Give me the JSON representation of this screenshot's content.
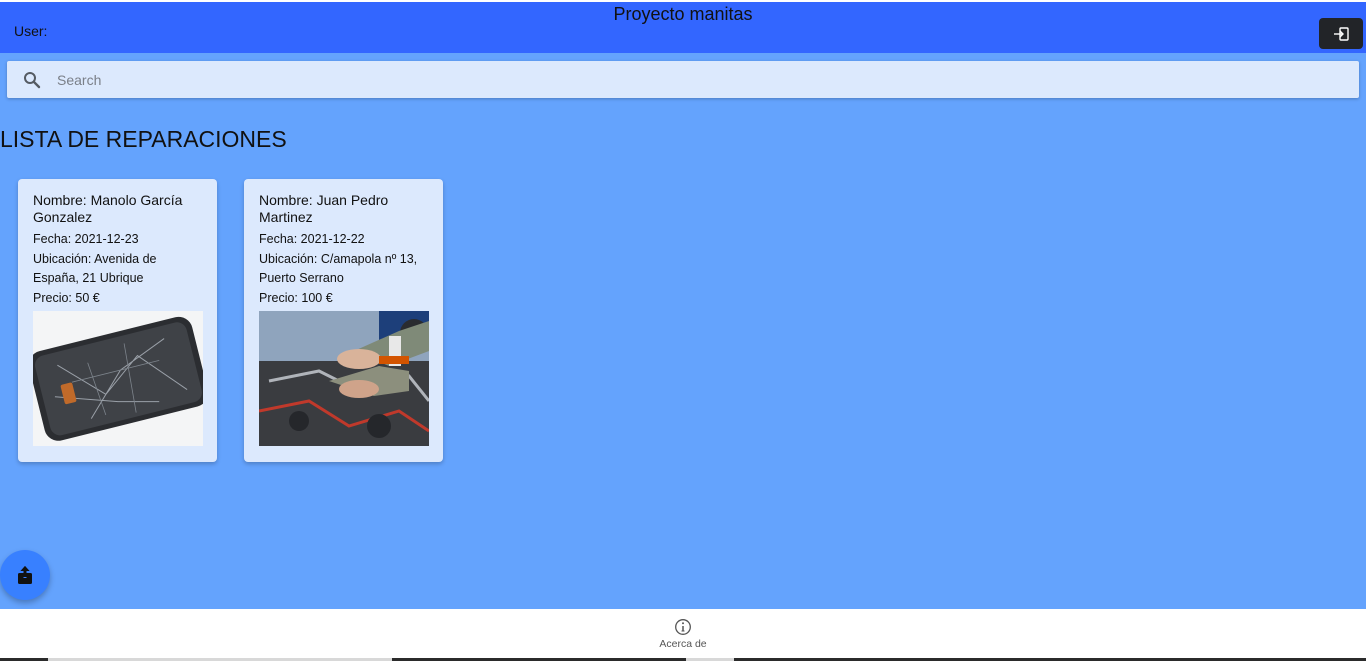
{
  "header": {
    "title": "Proyecto manitas",
    "user_label": "User:",
    "logout_icon": "log-in-icon"
  },
  "search": {
    "placeholder": "Search",
    "value": ""
  },
  "list_title": "LISTA DE REPARACIONES",
  "cards": [
    {
      "nombre": "Nombre: Manolo García Gonzalez",
      "fecha": "Fecha: 2021-12-23",
      "ubicacion": "Ubicación: Avenida de España, 21 Ubrique",
      "precio": "Precio: 50 €",
      "image": "broken-phone-photo"
    },
    {
      "nombre": "Nombre: Juan Pedro Martinez",
      "fecha": "Fecha: 2021-12-22",
      "ubicacion": "Ubicación: C/amapola nº 13, Puerto Serrano",
      "precio": "Precio: 100 €",
      "image": "car-engine-repair-photo"
    }
  ],
  "fab_icon": "share-icon",
  "tabbar": {
    "about_label": "Acerca de",
    "about_icon": "info-icon"
  },
  "colors": {
    "toolbar": "#3366ff",
    "background": "#64a3fd",
    "card": "#dce9fd",
    "fab": "#3880ff",
    "logout_button": "#222428"
  }
}
